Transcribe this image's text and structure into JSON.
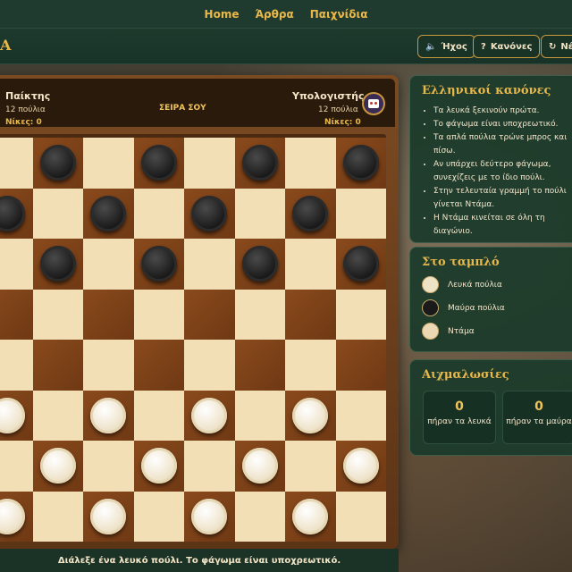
{
  "nav": {
    "links": [
      "Home",
      "Άρθρα",
      "Παιχνίδια"
    ]
  },
  "header": {
    "logo_fragment": "A",
    "buttons": {
      "sound": "Ήχος",
      "rules": "Κανόνες",
      "new": "Νέα"
    }
  },
  "scoreboard": {
    "player": {
      "name": "Παίκτης",
      "pieces": "12 πούλια",
      "wins": "Νίκες: 0"
    },
    "turn": "ΣΕΙΡΑ ΣΟΥ",
    "computer": {
      "name": "Υπολογιστής",
      "pieces": "12 πούλια",
      "wins": "Νίκες: 0"
    }
  },
  "board": {
    "pieces": [
      {
        "row": 0,
        "col": 1,
        "color": "black"
      },
      {
        "row": 0,
        "col": 3,
        "color": "black"
      },
      {
        "row": 0,
        "col": 5,
        "color": "black"
      },
      {
        "row": 0,
        "col": 7,
        "color": "black"
      },
      {
        "row": 1,
        "col": 0,
        "color": "black"
      },
      {
        "row": 1,
        "col": 2,
        "color": "black"
      },
      {
        "row": 1,
        "col": 4,
        "color": "black"
      },
      {
        "row": 1,
        "col": 6,
        "color": "black"
      },
      {
        "row": 2,
        "col": 1,
        "color": "black"
      },
      {
        "row": 2,
        "col": 3,
        "color": "black"
      },
      {
        "row": 2,
        "col": 5,
        "color": "black"
      },
      {
        "row": 2,
        "col": 7,
        "color": "black"
      },
      {
        "row": 5,
        "col": 0,
        "color": "white"
      },
      {
        "row": 5,
        "col": 2,
        "color": "white"
      },
      {
        "row": 5,
        "col": 4,
        "color": "white"
      },
      {
        "row": 5,
        "col": 6,
        "color": "white"
      },
      {
        "row": 6,
        "col": 1,
        "color": "white"
      },
      {
        "row": 6,
        "col": 3,
        "color": "white"
      },
      {
        "row": 6,
        "col": 5,
        "color": "white"
      },
      {
        "row": 6,
        "col": 7,
        "color": "white"
      },
      {
        "row": 7,
        "col": 0,
        "color": "white"
      },
      {
        "row": 7,
        "col": 2,
        "color": "white"
      },
      {
        "row": 7,
        "col": 4,
        "color": "white"
      },
      {
        "row": 7,
        "col": 6,
        "color": "white"
      }
    ]
  },
  "status": "Διάλεξε ένα λευκό πούλι. Το φάγωμα είναι υποχρεωτικό.",
  "rules_card": {
    "title": "Ελληνικοί κανόνες",
    "items": [
      "Τα λευκά ξεκινούν πρώτα.",
      "Το φάγωμα είναι υποχρεωτικό.",
      "Τα απλά πούλια τρώνε μπρος και πίσω.",
      "Αν υπάρχει δεύτερο φάγωμα, συνεχίζεις με το ίδιο πούλι.",
      "Στην τελευταία γραμμή το πούλι γίνεται Ντάμα.",
      "Η Ντάμα κινείται σε όλη τη διαγώνιο."
    ]
  },
  "legend_card": {
    "title": "Στο ταμπλό",
    "items": [
      {
        "label": "Λευκά πούλια",
        "color": "#efe3c6"
      },
      {
        "label": "Μαύρα πούλια",
        "color": "#1a1a1a"
      },
      {
        "label": "Ντάμα",
        "color": "#ecd9b4"
      }
    ]
  },
  "captures_card": {
    "title": "Αιχμαλωσίες",
    "white": {
      "count": "0",
      "label": "πήραν τα λευκά"
    },
    "black": {
      "count": "0",
      "label": "πήραν τα μαύρα"
    }
  }
}
